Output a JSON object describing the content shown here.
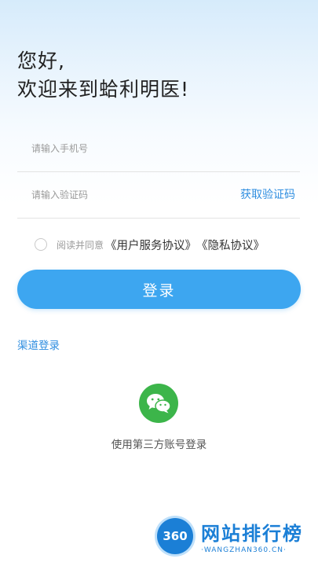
{
  "greeting": {
    "line1": "您好,",
    "line2": "欢迎来到蛤利明医!"
  },
  "phone": {
    "placeholder": "请输入手机号",
    "value": ""
  },
  "code": {
    "placeholder": "请输入验证码",
    "value": "",
    "get_code_label": "获取验证码"
  },
  "agreement": {
    "checked": false,
    "prefix": "阅读并同意",
    "user_agreement": "《用户服务协议》",
    "privacy_agreement": "《隐私协议》"
  },
  "login_button_label": "登录",
  "channel_login_label": "渠道登录",
  "third_party": {
    "icon": "wechat-icon",
    "label": "使用第三方账号登录"
  },
  "watermark": {
    "logo_text": "360",
    "title": "网站排行榜",
    "subtitle": "·WANGZHAN360.CN·"
  },
  "colors": {
    "primary": "#3da6f0",
    "link": "#2f8ee0",
    "wechat": "#3cb54a",
    "watermark": "#1b7fd6"
  }
}
